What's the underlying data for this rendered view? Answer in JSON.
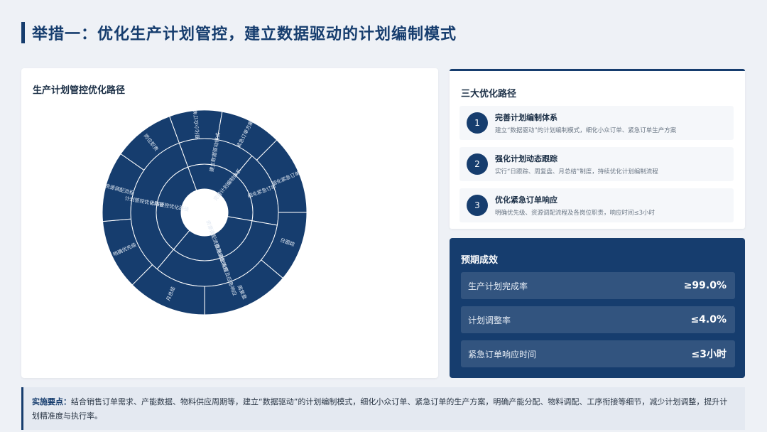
{
  "header": {
    "title": "举措一：优化生产计划管控，建立数据驱动的计划编制模式"
  },
  "left_card": {
    "title": "生产计划管控优化路径",
    "sunburst": {
      "center_label": "生产计划管控优化路径",
      "rings": [
        {
          "level": 1,
          "segments": [
            {
              "label": "完善计划编制体系",
              "value": 100
            },
            {
              "label": "资源调配流程及应急响应",
              "value": 100
            },
            {
              "label": "计划管控优化路径",
              "value": 100
            }
          ]
        },
        {
          "level": 2,
          "segments": [
            {
              "label": "建立数据驱动模式",
              "value": 50
            },
            {
              "label": "细化紧急订单",
              "value": 50
            },
            {
              "label": "资源调配流程及应急响应",
              "value": 100
            },
            {
              "label": "计划管控优化路径",
              "value": 100
            }
          ]
        },
        {
          "level": 3,
          "segments": [
            {
              "label": "细化小众订单",
              "value": 30
            },
            {
              "label": "紧急订单方案",
              "value": 35
            },
            {
              "label": "细化紧急订单",
              "value": 45
            },
            {
              "label": "日跟踪",
              "value": 40
            },
            {
              "label": "周复盘",
              "value": 50
            },
            {
              "label": "月总结",
              "value": 45
            },
            {
              "label": "明确优先级",
              "value": 40
            },
            {
              "label": "资源调配流程",
              "value": 40
            },
            {
              "label": "岗位职责",
              "value": 35
            }
          ]
        }
      ]
    }
  },
  "paths_card": {
    "title": "三大优化路径",
    "items": [
      {
        "num": "1",
        "title": "完善计划编制体系",
        "desc": "建立“数据驱动”的计划编制模式，细化小众订单、紧急订单生产方案"
      },
      {
        "num": "2",
        "title": "强化计划动态跟踪",
        "desc": "实行“日跟踪、周复盘、月总结”制度，持续优化计划编制流程"
      },
      {
        "num": "3",
        "title": "优化紧急订单响应",
        "desc": "明确优先级、资源调配流程及各岗位职责，响应时间≤3小时"
      }
    ]
  },
  "effect_card": {
    "title": "预期成效",
    "metrics": [
      {
        "label": "生产计划完成率",
        "value": "≥99.0%"
      },
      {
        "label": "计划调整率",
        "value": "≤4.0%"
      },
      {
        "label": "紧急订单响应时间",
        "value": "≤3小时"
      }
    ]
  },
  "note": {
    "key": "实施要点：",
    "text": "结合销售订单需求、产能数据、物料供应周期等，建立“数据驱动”的计划编制模式，细化小众订单、紧急订单的生产方案，明确产能分配、物料调配、工序衔接等细节，减少计划调整，提升计划精准度与执行率。"
  },
  "colors": {
    "primary": "#163d6e",
    "background": "#eef1f6",
    "card": "#ffffff"
  }
}
